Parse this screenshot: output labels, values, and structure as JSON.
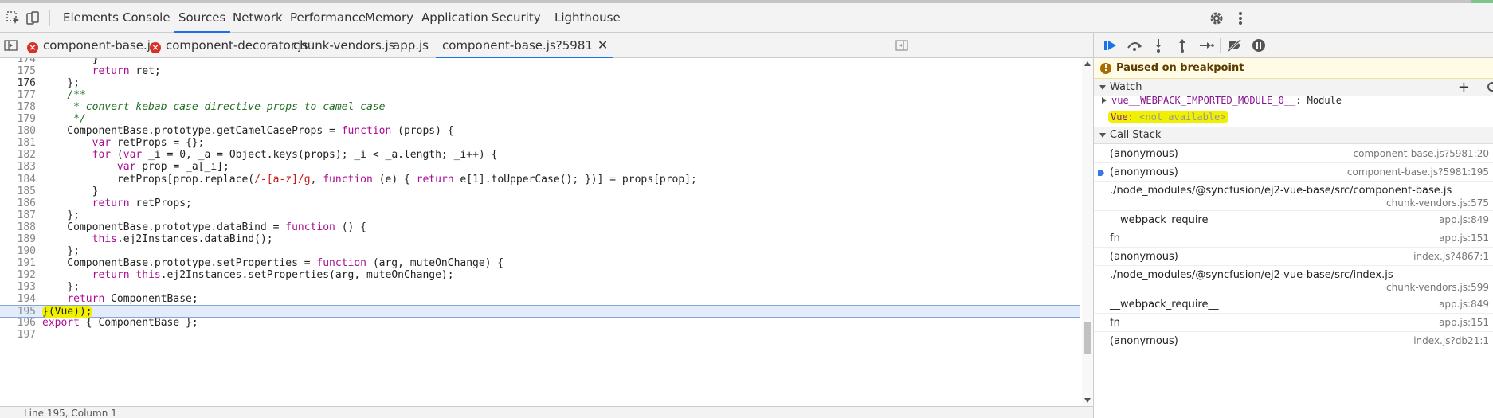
{
  "main_tabs": [
    "Elements",
    "Console",
    "Sources",
    "Network",
    "Performance",
    "Memory",
    "Application",
    "Security",
    "Lighthouse"
  ],
  "active_main_tab": "Sources",
  "file_tabs": [
    {
      "label": "component-base.js",
      "error": true
    },
    {
      "label": "component-decorator.js",
      "error": true
    },
    {
      "label": "chunk-vendors.js",
      "error": false
    },
    {
      "label": "app.js",
      "error": false
    },
    {
      "label": "component-base.js?5981",
      "error": false,
      "active": true
    }
  ],
  "close_label": "✕",
  "code_lines": [
    {
      "n": "174",
      "html": "        }"
    },
    {
      "n": "175",
      "html": "        <span class='kw'>return</span> ret;"
    },
    {
      "n": "176",
      "html": "    };"
    },
    {
      "n": "177",
      "html": "    <span class='cm'>/**</span>"
    },
    {
      "n": "178",
      "html": "<span class='cm'>     * convert kebab case directive props to camel case</span>"
    },
    {
      "n": "179",
      "html": "<span class='cm'>     */</span>"
    },
    {
      "n": "180",
      "html": "    ComponentBase.prototype.getCamelCaseProps = <span class='kw'>function</span> (props) {"
    },
    {
      "n": "181",
      "html": "        <span class='kw'>var</span> retProps = {};"
    },
    {
      "n": "182",
      "html": "        <span class='kw'>for</span> (<span class='kw'>var</span> _i = 0, _a = Object.keys(props); _i &lt; _a.length; _i++) {"
    },
    {
      "n": "183",
      "html": "            <span class='kw'>var</span> prop = _a[_i];"
    },
    {
      "n": "184",
      "html": "            retProps[prop.replace(<span class='rx'>/-[a-z]/g</span>, <span class='kw'>function</span> (e) { <span class='kw'>return</span> e[1].toUpperCase(); })] = props[prop];"
    },
    {
      "n": "185",
      "html": "        }"
    },
    {
      "n": "186",
      "html": "        <span class='kw'>return</span> retProps;"
    },
    {
      "n": "187",
      "html": "    };"
    },
    {
      "n": "188",
      "html": "    ComponentBase.prototype.dataBind = <span class='kw'>function</span> () {"
    },
    {
      "n": "189",
      "html": "        <span class='kw'>this</span>.ej2Instances.dataBind();"
    },
    {
      "n": "190",
      "html": "    };"
    },
    {
      "n": "191",
      "html": "    ComponentBase.prototype.setProperties = <span class='kw'>function</span> (arg, muteOnChange) {"
    },
    {
      "n": "192",
      "html": "        <span class='kw'>return</span> <span class='kw'>this</span>.ej2Instances.setProperties(arg, muteOnChange);"
    },
    {
      "n": "193",
      "html": "    };"
    },
    {
      "n": "194",
      "html": "    <span class='kw'>return</span> ComponentBase;"
    },
    {
      "n": "195",
      "html": "<span class='yel'>}(Vue));</span>",
      "highlight": true
    },
    {
      "n": "196",
      "html": "<span class='kw'>export</span> { ComponentBase };"
    },
    {
      "n": "197",
      "html": ""
    }
  ],
  "paused_label": "Paused on breakpoint",
  "watch_title": "Watch",
  "watch_add": "+",
  "watch_items": {
    "item1_name": "vue__WEBPACK_IMPORTED_MODULE_0__",
    "item1_value": "Module",
    "item2_name": "Vue:",
    "item2_value": "<not available>"
  },
  "callstack_title": "Call Stack",
  "callstack": [
    {
      "fn": "(anonymous)",
      "loc": "component-base.js?5981:20"
    },
    {
      "fn": "(anonymous)",
      "loc": "component-base.js?5981:195",
      "current": true
    },
    {
      "fn": "./node_modules/@syncfusion/ej2-vue-base/src/component-base.js",
      "loc": "chunk-vendors.js:575",
      "two_line": true
    },
    {
      "fn": "__webpack_require__",
      "loc": "app.js:849"
    },
    {
      "fn": "fn",
      "loc": "app.js:151"
    },
    {
      "fn": "(anonymous)",
      "loc": "index.js?4867:1"
    },
    {
      "fn": "./node_modules/@syncfusion/ej2-vue-base/src/index.js",
      "loc": "chunk-vendors.js:599",
      "two_line": true
    },
    {
      "fn": "__webpack_require__",
      "loc": "app.js:849"
    },
    {
      "fn": "fn",
      "loc": "app.js:151"
    },
    {
      "fn": "(anonymous)",
      "loc": "index.js?db21:1"
    }
  ],
  "status_text": "Line 195, Column 1"
}
